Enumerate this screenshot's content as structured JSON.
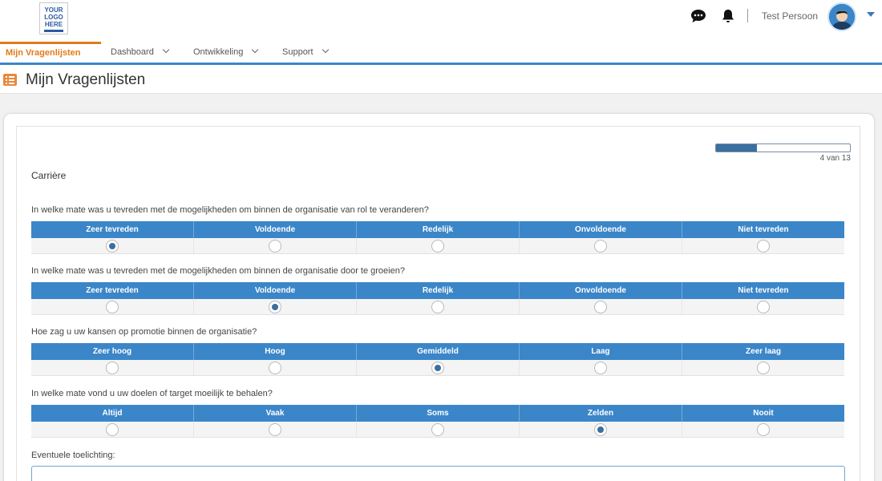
{
  "header": {
    "logo_lines": [
      "YOUR",
      "LOGO",
      "HERE"
    ],
    "username": "Test Persoon",
    "icons": {
      "chat": "chat-icon",
      "bell": "bell-icon",
      "avatar": "avatar",
      "caret": "caret-down-icon"
    }
  },
  "nav": {
    "items": [
      {
        "label": "Mijn Vragenlijsten",
        "active": true
      },
      {
        "label": "Dashboard",
        "active": false
      },
      {
        "label": "Ontwikkeling",
        "active": false
      },
      {
        "label": "Support",
        "active": false
      }
    ]
  },
  "page": {
    "title": "Mijn Vragenlijsten",
    "icon": "list-icon"
  },
  "progress": {
    "label": "4 van 13",
    "current": 4,
    "total": 13
  },
  "section": {
    "title": "Carrière"
  },
  "questions": [
    {
      "text": "In welke mate was u tevreden met de mogelijkheden om binnen de organisatie van rol te veranderen?",
      "options": [
        "Zeer tevreden",
        "Voldoende",
        "Redelijk",
        "Onvoldoende",
        "Niet tevreden"
      ],
      "selected": 0
    },
    {
      "text": "In welke mate was u tevreden met de mogelijkheden om binnen de organisatie door te groeien?",
      "options": [
        "Zeer tevreden",
        "Voldoende",
        "Redelijk",
        "Onvoldoende",
        "Niet tevreden"
      ],
      "selected": 1
    },
    {
      "text": "Hoe zag u uw kansen op promotie binnen de organisatie?",
      "options": [
        "Zeer hoog",
        "Hoog",
        "Gemiddeld",
        "Laag",
        "Zeer laag"
      ],
      "selected": 2
    },
    {
      "text": "In welke mate vond u uw doelen of target moeilijk te behalen?",
      "options": [
        "Altijd",
        "Vaak",
        "Soms",
        "Zelden",
        "Nooit"
      ],
      "selected": 3
    }
  ],
  "note": {
    "label": "Eventuele toelichting:",
    "value": "",
    "placeholder": ""
  },
  "colors": {
    "accent": "#3b86c8",
    "active_nav": "#e07b1a",
    "radio_fill": "#3a6f9f"
  }
}
